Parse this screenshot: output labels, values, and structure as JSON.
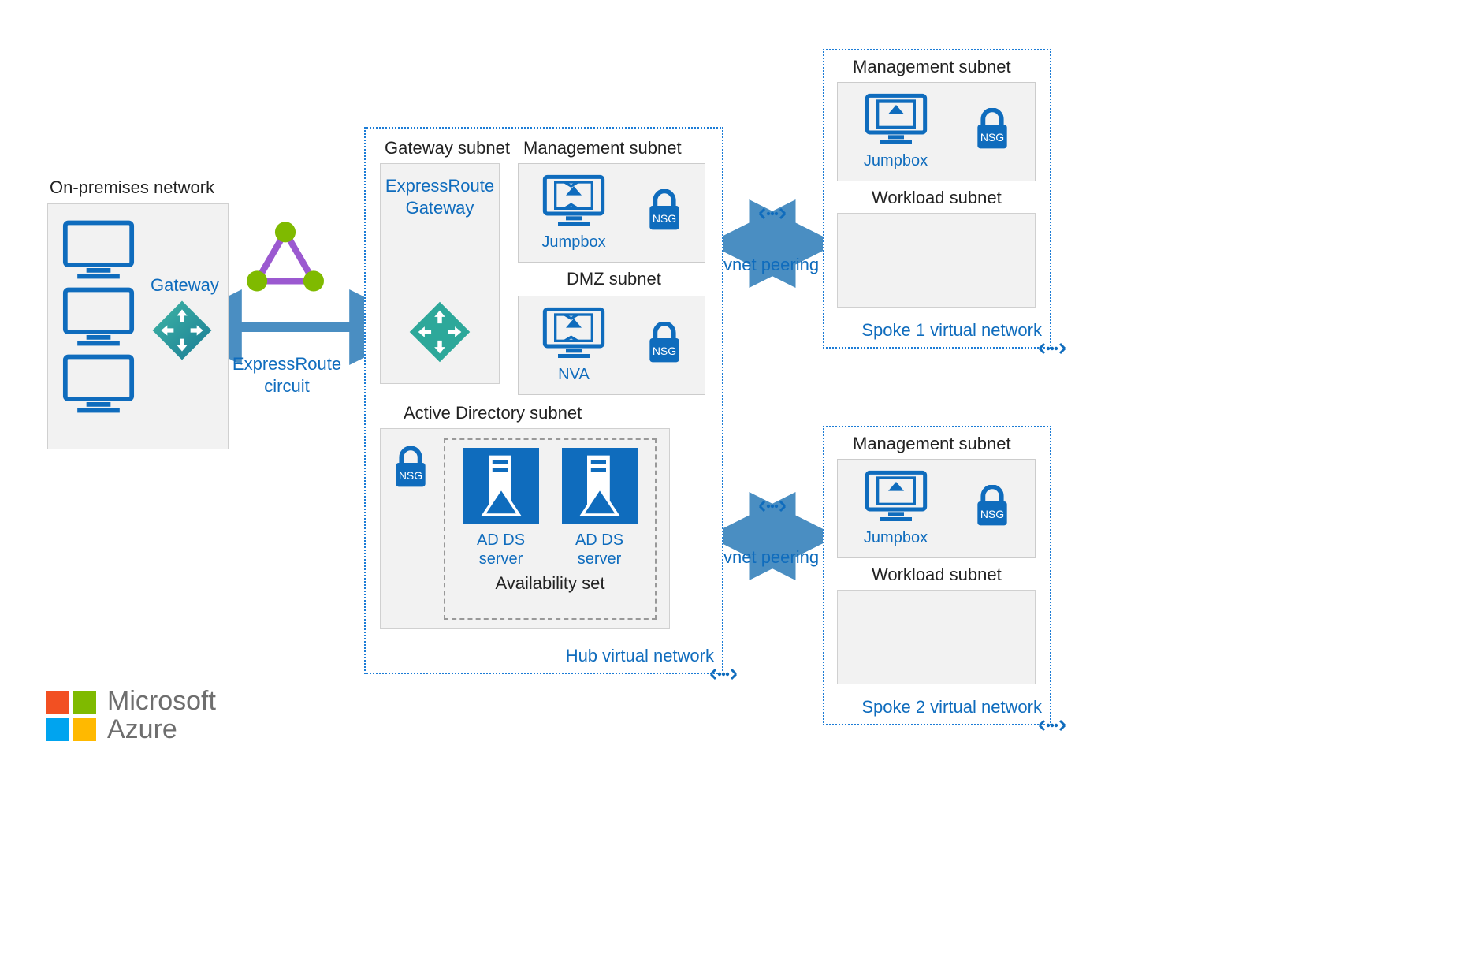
{
  "onprem": {
    "title": "On-premises network",
    "gateway": "Gateway"
  },
  "expressroute": {
    "circuit": "ExpressRoute circuit"
  },
  "hub": {
    "label": "Hub virtual network",
    "gateway_subnet": {
      "title": "Gateway subnet",
      "gw": "ExpressRoute Gateway"
    },
    "mgmt_subnet": {
      "title": "Management subnet",
      "jumpbox": "Jumpbox",
      "nsg": "NSG"
    },
    "dmz_subnet": {
      "title": "DMZ subnet",
      "nva": "NVA",
      "nsg": "NSG"
    },
    "ad_subnet": {
      "title": "Active Directory subnet",
      "nsg": "NSG",
      "adds1": "AD DS server",
      "adds2": "AD DS server",
      "avail": "Availability set"
    }
  },
  "peering": {
    "label1": "vnet peering",
    "label2": "vnet peering"
  },
  "spoke1": {
    "label": "Spoke 1 virtual network",
    "mgmt": {
      "title": "Management subnet",
      "jumpbox": "Jumpbox",
      "nsg": "NSG"
    },
    "workload": {
      "title": "Workload subnet"
    }
  },
  "spoke2": {
    "label": "Spoke 2 virtual network",
    "mgmt": {
      "title": "Management subnet",
      "jumpbox": "Jumpbox",
      "nsg": "NSG"
    },
    "workload": {
      "title": "Workload subnet"
    }
  },
  "logo": {
    "brand": "Microsoft",
    "product": "Azure"
  }
}
